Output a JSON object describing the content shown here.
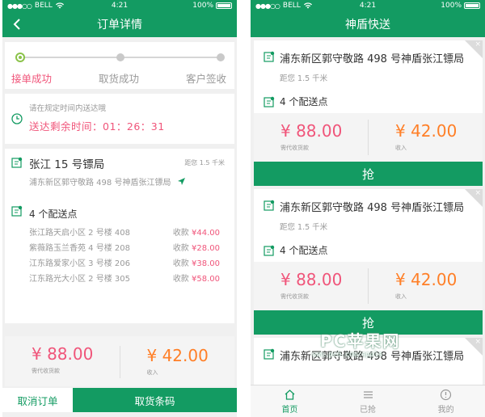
{
  "status_bar": {
    "carrier": "BELL",
    "time": "4:21",
    "battery": "100%"
  },
  "detail": {
    "nav_title": "订单详情",
    "steps": [
      "接单成功",
      "取货成功",
      "客户签收"
    ],
    "timer_hint": "请在规定时间内送达哦",
    "timer_text": "送达剩余时间：01：26：31",
    "pickup_title": "张江 15 号镖局",
    "pickup_distance": "距您 1.5 千米",
    "pickup_address": "浦东新区郭守敬路 498 号神盾张江镖局",
    "points_label": "4 个配送点",
    "stops": [
      {
        "address": "张江路天启小区 2 号楼 408",
        "amount_label": "收款",
        "amount": "¥44.00"
      },
      {
        "address": "紫薇路玉兰香苑 4 号楼 208",
        "amount_label": "收款",
        "amount": "¥28.00"
      },
      {
        "address": "江东路爱家小区 3 号楼 206",
        "amount_label": "收款",
        "amount": "¥38.00"
      },
      {
        "address": "江东路光大小区 2 号楼 305",
        "amount_label": "收款",
        "amount": "¥58.00"
      }
    ],
    "collect_amount": "¥ 88.00",
    "collect_caption": "需代收货款",
    "income_amount": "¥ 42.00",
    "income_caption": "收入",
    "cancel_button": "取消订单",
    "code_button": "取货条码"
  },
  "list": {
    "nav_title": "神盾快送",
    "close_glyph": "×",
    "tasks": [
      {
        "title": "浦东新区郭守敬路 498 号神盾张江镖局",
        "distance": "距您 1.5 千米",
        "points": "4 个配送点",
        "collect_amount": "¥ 88.00",
        "collect_caption": "需代收货款",
        "income_amount": "¥ 42.00",
        "income_caption": "收入",
        "grab_label": "抢"
      },
      {
        "title": "浦东新区郭守敬路 498 号神盾张江镖局",
        "distance": "距您 1.5 千米",
        "points": "4 个配送点",
        "collect_amount": "¥ 88.00",
        "collect_caption": "需代收货款",
        "income_amount": "¥ 42.00",
        "income_caption": "收入",
        "grab_label": "抢"
      },
      {
        "title": "浦东新区郭守敬路 498 号神盾张江镖局"
      }
    ],
    "tabs": [
      {
        "label": "首页",
        "icon": "home-icon"
      },
      {
        "label": "已抢",
        "icon": "list-icon"
      },
      {
        "label": "我的",
        "icon": "profile-icon"
      }
    ]
  },
  "watermark": {
    "main": "PC苹果网",
    "sub": "www.pc6.com/apple"
  },
  "colors": {
    "brand_green": "#139b62",
    "price_pink": "#f0557a",
    "income_orange": "#ff7f27",
    "progress_green": "#8bc34a"
  }
}
